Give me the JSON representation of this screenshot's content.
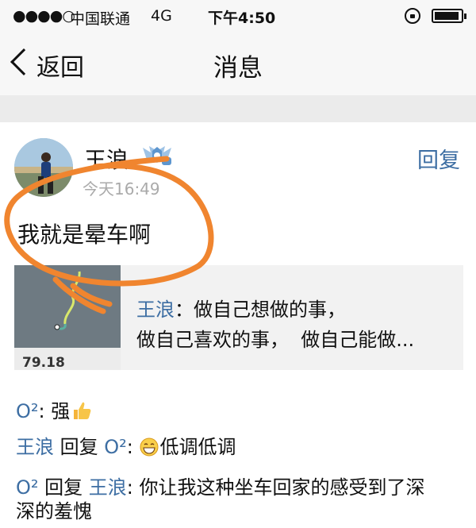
{
  "status_bar": {
    "signal": "●●●●○",
    "carrier": "中国联通",
    "network": "4G",
    "time": "下午4:50"
  },
  "nav": {
    "back_label": "返回",
    "title": "消息"
  },
  "post": {
    "username": "王浪",
    "timestamp": "今天16:49",
    "reply_label": "回复",
    "text": "我就是晕车啊",
    "share": {
      "author": "王浪",
      "sep": "：",
      "line1": "做自己想做的事，",
      "line2": "做自己喜欢的事，  做自己能做...",
      "thumb_number": "79.18"
    }
  },
  "comments": [
    {
      "author": "O²",
      "sep": ": ",
      "text": "强"
    },
    {
      "author": "王浪",
      "reply_word": " 回复 ",
      "target": "O²",
      "sep": ": ",
      "text": "低调低调"
    },
    {
      "author": "O²",
      "reply_word": " 回复 ",
      "target": "王浪",
      "sep": ": ",
      "text": "你让我这种坐车回家的感受到了深",
      "text_cont": "深的羞愧"
    }
  ],
  "colors": {
    "link_blue": "#3d6ea3",
    "annotation_orange": "#f0852f"
  }
}
